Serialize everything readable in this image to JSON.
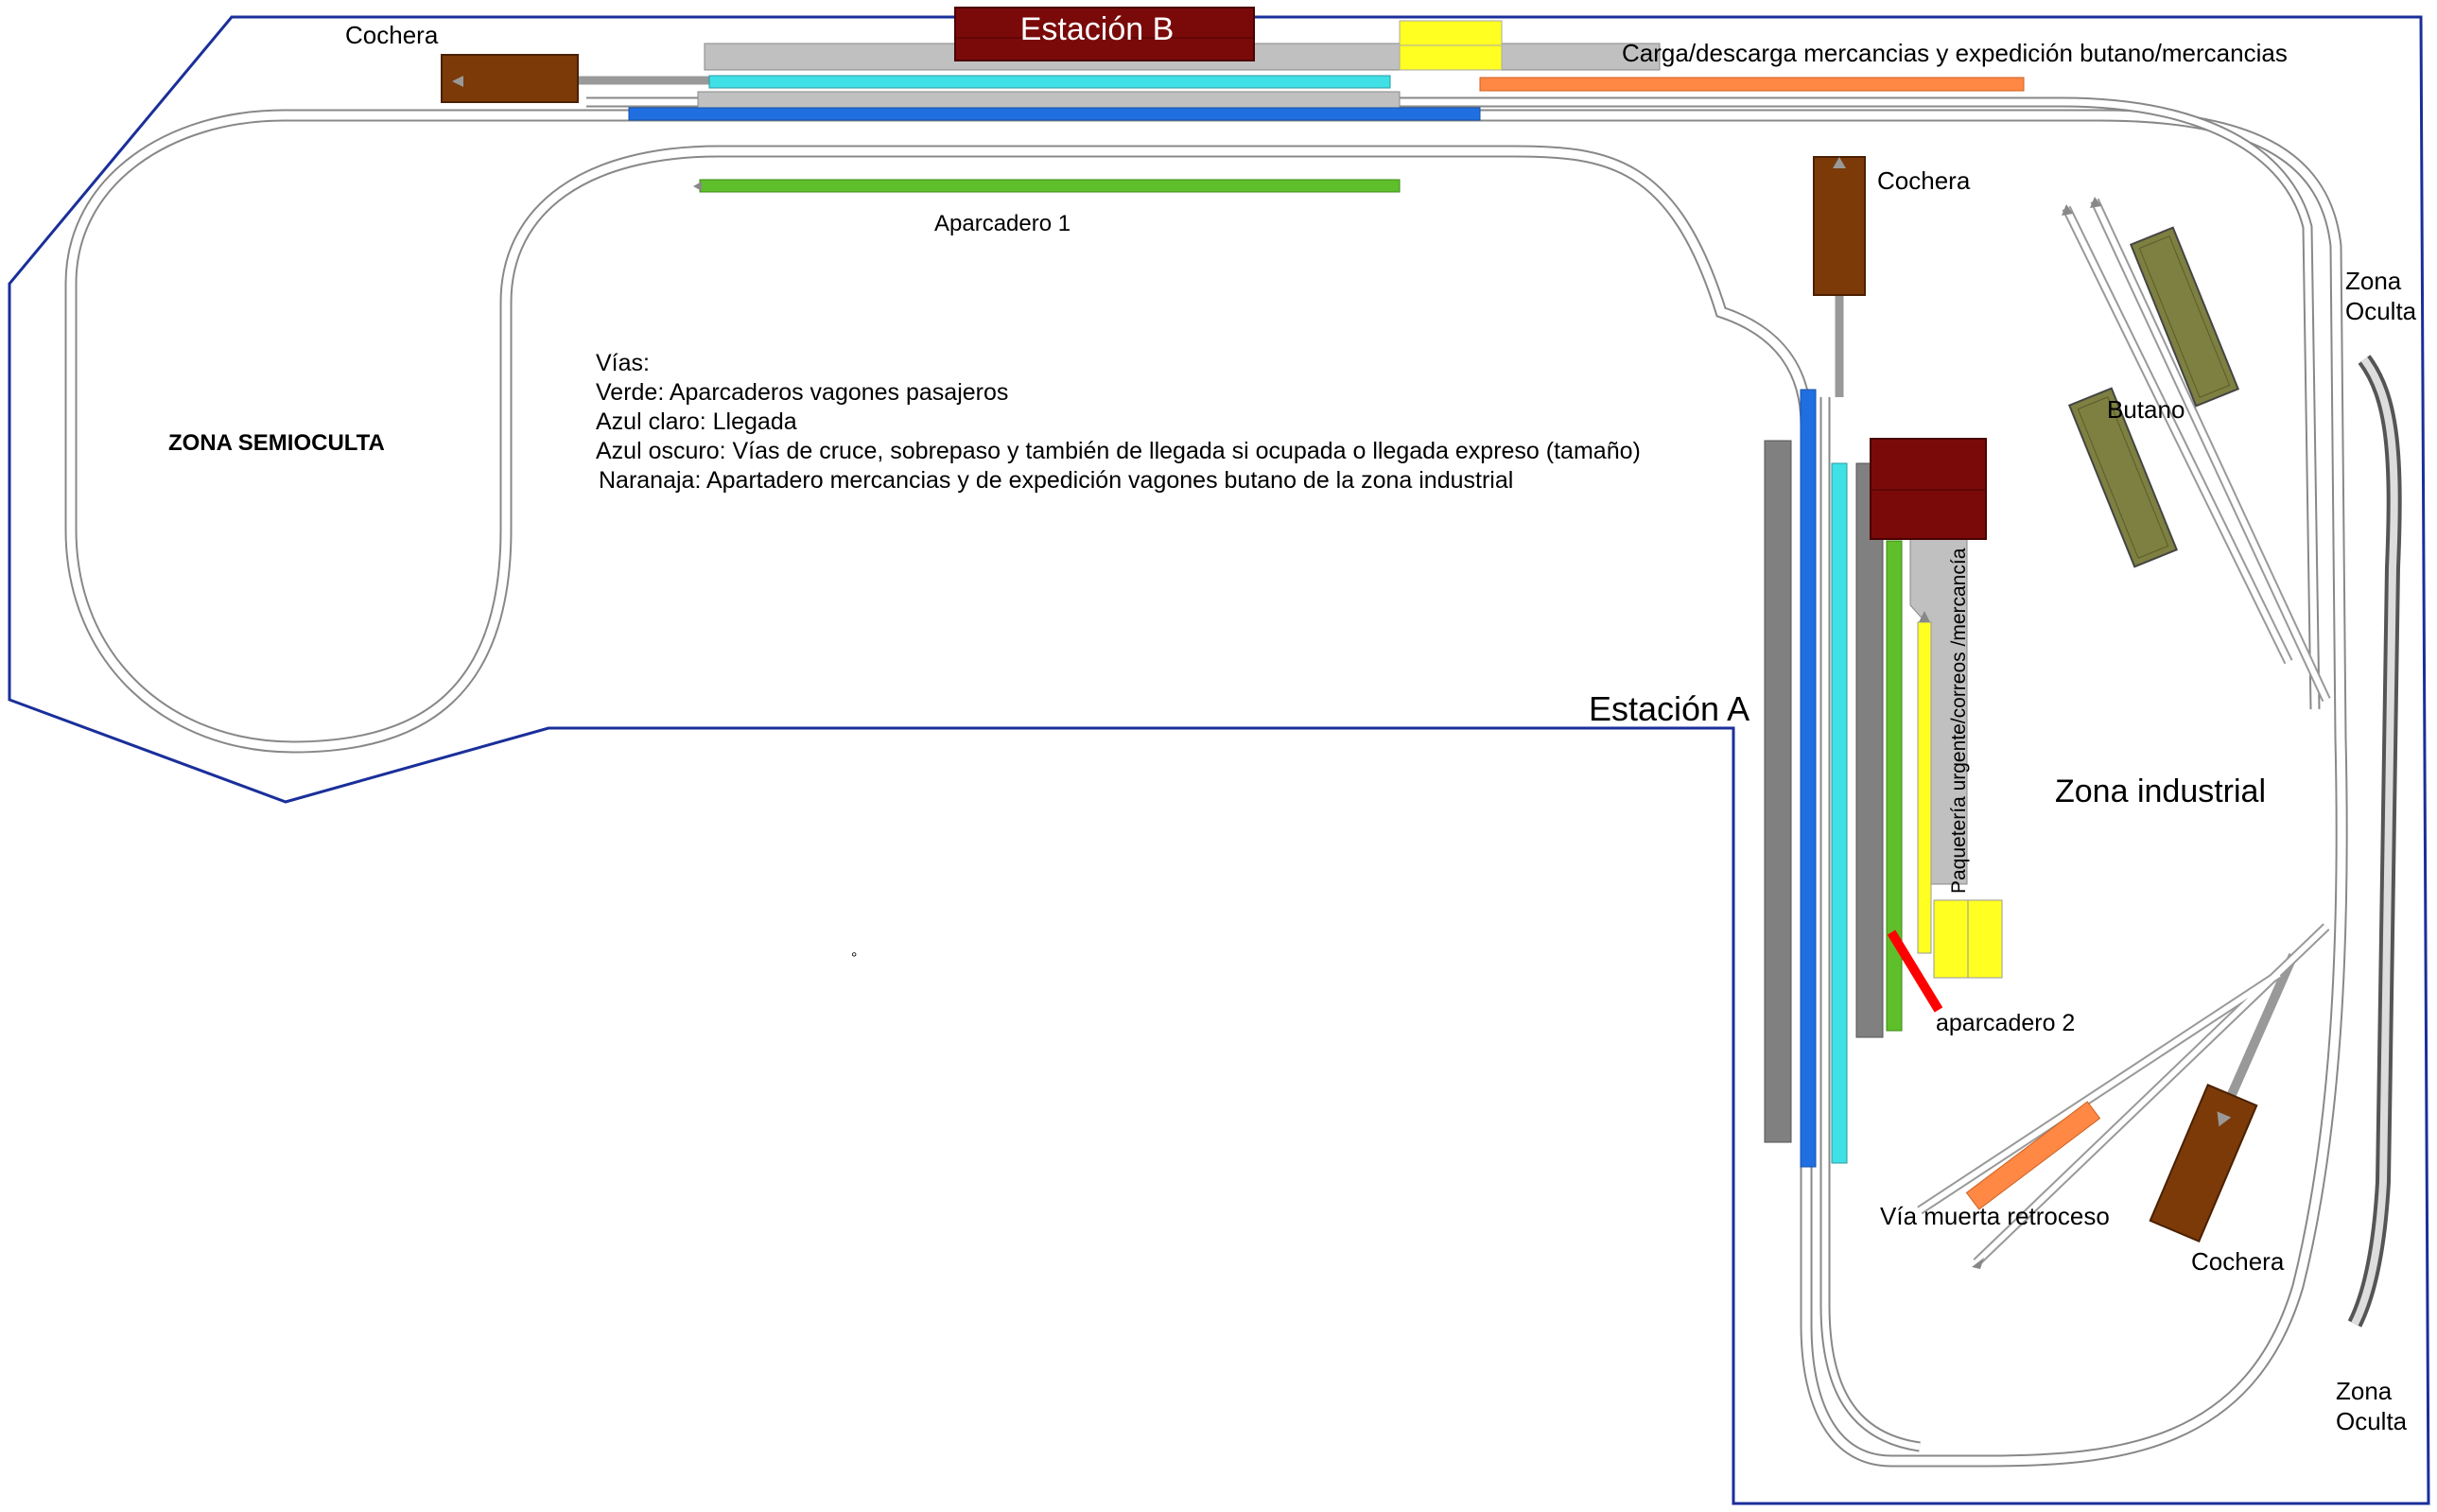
{
  "title_station_b": "Estación B",
  "labels": {
    "cochera": "Cochera",
    "carga": "Carga/descarga mercancias y expedición butano/mercancias",
    "aparcadero_1": "Aparcadero 1",
    "aparcadero_2": "aparcadero 2",
    "zona_semioculta": "ZONA SEMIOCULTA",
    "estacion_a": "Estación A",
    "zona_industrial": "Zona industrial",
    "butano": "Butano",
    "paqueteria": "Paquetería urgente/correos /mercancía",
    "via_muerta": "Vía muerta retroceso",
    "zona_oculta_1": "Zona",
    "zona_oculta_2": "Oculta",
    "small_mark": "°"
  },
  "legend": {
    "heading": "Vías:",
    "lines": [
      "Verde: Aparcaderos vagones pasajeros",
      "Azul claro: Llegada",
      "Azul oscuro: Vías de cruce, sobrepaso y también de llegada si ocupada o llegada expreso (tamaño)",
      "Naranaja: Apartadero mercancias y de expedición vagones butano de la zona industrial"
    ]
  },
  "colors": {
    "boundary": "#1a2f9a",
    "track_green": "#5fbf2a",
    "track_light_blue": "#3fe0e6",
    "track_dark_blue": "#1f6fe0",
    "track_orange": "#ff8844",
    "station_building": "#7a0a0a",
    "shed_brown": "#7b3a08",
    "platform_gray": "#c0c0c0",
    "platform_dark_gray": "#808080",
    "yellow": "#ffff22",
    "butane_tank": "#7d8040",
    "signal_red": "#ff0000"
  }
}
